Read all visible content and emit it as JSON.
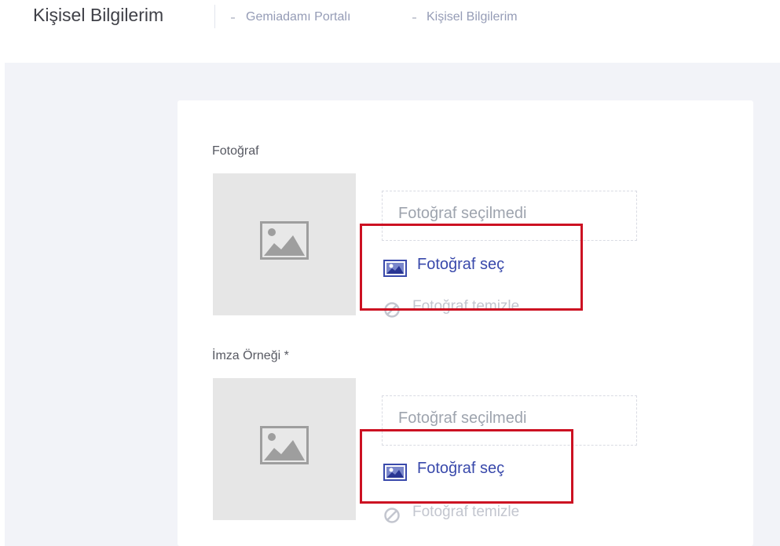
{
  "header": {
    "title": "Kişisel Bilgilerim",
    "breadcrumb": [
      "Gemiadamı Portalı",
      "Kişisel Bilgilerim"
    ]
  },
  "form": {
    "photo": {
      "label": "Fotoğraf",
      "empty_text": "Fotoğraf seçilmedi",
      "select_label": "Fotoğraf seç",
      "clear_label": "Fotoğraf temizle"
    },
    "signature": {
      "label": "İmza Örneği *",
      "empty_text": "Fotoğraf seçilmedi",
      "select_label": "Fotoğraf seç",
      "clear_label": "Fotoğraf temizle"
    }
  },
  "icons": {
    "placeholder": "image-placeholder-icon",
    "select": "image-icon",
    "clear": "ban-icon"
  },
  "colors": {
    "link": "#3949ab",
    "highlight": "#cc1122",
    "content_bg": "#f2f3f8",
    "thumbnail_bg": "#e6e6e6",
    "muted_text": "#9ea4ae"
  }
}
